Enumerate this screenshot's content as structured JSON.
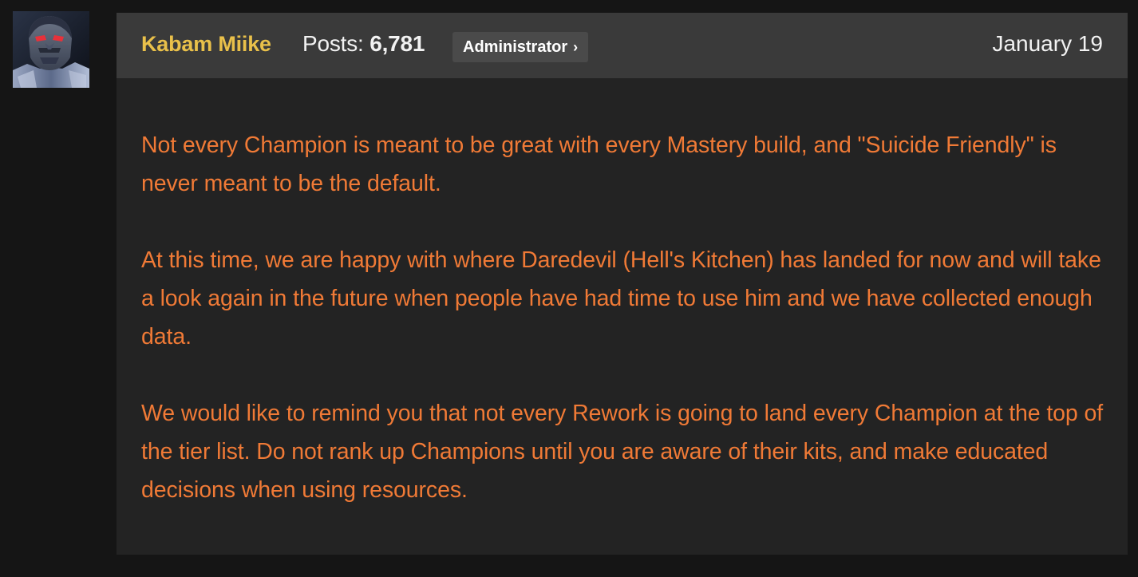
{
  "post": {
    "author": "Kabam Miike",
    "posts_label": "Posts:",
    "posts_count": "6,781",
    "role": "Administrator",
    "date": "January 19",
    "paragraphs": [
      "Not every Champion is meant to be great with every Mastery build, and \"Suicide Friendly\" is never meant to be the default.",
      "At this time, we are happy with where Daredevil (Hell's Kitchen) has landed for now and will take a look again in the future when people have had time to use him and we have collected enough data.",
      "We would like to remind you that not every Rework is going to land every Champion at the top of the tier list. Do not rank up Champions until you are aware of their kits, and make educated decisions when using resources."
    ]
  },
  "icons": {
    "avatar": "champion-portrait-avatar",
    "badge_chevron": "chevron-right-icon"
  },
  "colors": {
    "page_background": "#151515",
    "post_background": "#232323",
    "header_background": "#3a3a3a",
    "author_name": "#e9c04a",
    "body_text": "#f07a36",
    "badge_background": "#4a4a4a"
  }
}
